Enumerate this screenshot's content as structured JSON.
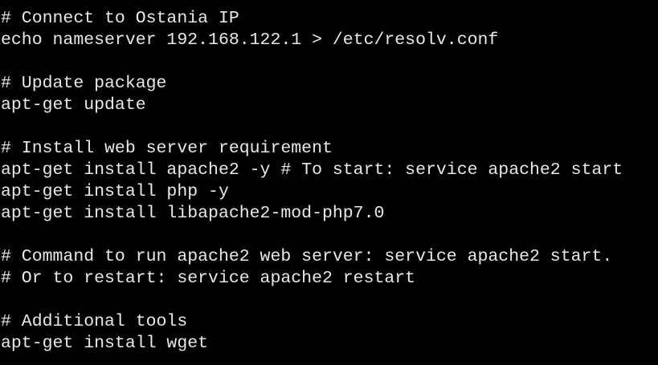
{
  "terminal": {
    "background": "#000000",
    "foreground": "#e8e8e8",
    "lines": [
      "# Connect to Ostania IP",
      "echo nameserver 192.168.122.1 > /etc/resolv.conf",
      "",
      "# Update package",
      "apt-get update",
      "",
      "# Install web server requirement",
      "apt-get install apache2 -y # To start: service apache2 start",
      "apt-get install php -y",
      "apt-get install libapache2-mod-php7.0",
      "",
      "# Command to run apache2 web server: service apache2 start.",
      "# Or to restart: service apache2 restart",
      "",
      "# Additional tools",
      "apt-get install wget"
    ]
  }
}
